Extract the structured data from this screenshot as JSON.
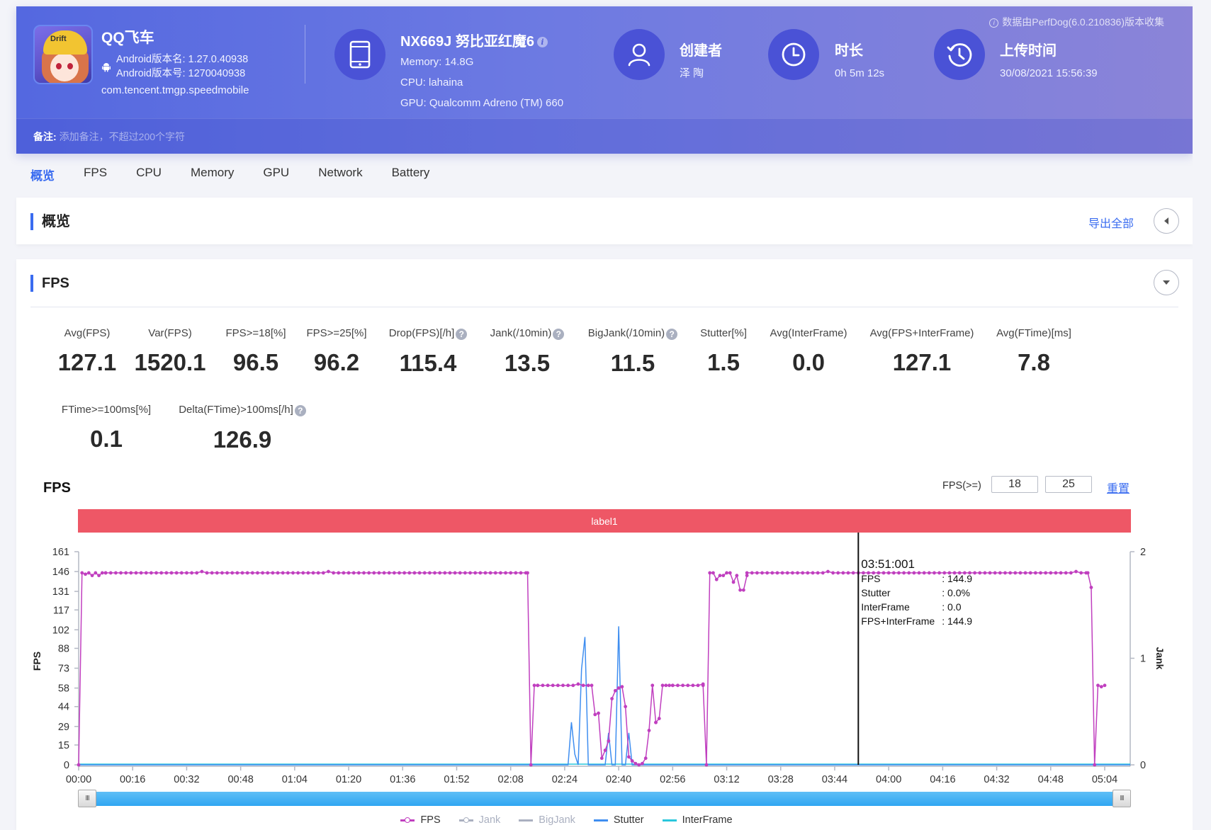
{
  "header": {
    "app": {
      "name": "QQ飞车",
      "version_name": "Android版本名: 1.27.0.40938",
      "version_code": "Android版本号: 1270040938",
      "package": "com.tencent.tmgp.speedmobile",
      "icon_text": "Drift"
    },
    "device": {
      "title": "NX669J 努比亚红魔6",
      "memory": "Memory: 14.8G",
      "cpu": "CPU: lahaina",
      "gpu": "GPU: Qualcomm Adreno (TM) 660",
      "info_icon": "i"
    },
    "creator": {
      "title": "创建者",
      "value": "泽 陶"
    },
    "duration": {
      "title": "时长",
      "value": "0h 5m 12s"
    },
    "upload": {
      "title": "上传时间",
      "value": "30/08/2021 15:56:39"
    },
    "collected_by": "数据由PerfDog(6.0.210836)版本收集",
    "notes_label": "备注:",
    "notes_placeholder": "添加备注，不超过200个字符"
  },
  "tabs": [
    {
      "label": "概览",
      "active": true
    },
    {
      "label": "FPS"
    },
    {
      "label": "CPU"
    },
    {
      "label": "Memory"
    },
    {
      "label": "GPU"
    },
    {
      "label": "Network"
    },
    {
      "label": "Battery"
    }
  ],
  "overview": {
    "title": "概览",
    "export_label": "导出全部"
  },
  "fps_section": {
    "title": "FPS",
    "metrics_row1": [
      {
        "label": "Avg(FPS)",
        "value": "127.1"
      },
      {
        "label": "Var(FPS)",
        "value": "1520.1"
      },
      {
        "label": "FPS>=18[%]",
        "value": "96.5"
      },
      {
        "label": "FPS>=25[%]",
        "value": "96.2"
      },
      {
        "label": "Drop(FPS)[/h]",
        "value": "115.4",
        "help": true
      },
      {
        "label": "Jank(/10min)",
        "value": "13.5",
        "help": true
      },
      {
        "label": "BigJank(/10min)",
        "value": "11.5",
        "help": true
      },
      {
        "label": "Stutter[%]",
        "value": "1.5"
      },
      {
        "label": "Avg(InterFrame)",
        "value": "0.0"
      },
      {
        "label": "Avg(FPS+InterFrame)",
        "value": "127.1"
      },
      {
        "label": "Avg(FTime)[ms]",
        "value": "7.8"
      }
    ],
    "metrics_row2": [
      {
        "label": "FTime>=100ms[%]",
        "value": "0.1"
      },
      {
        "label": "Delta(FTime)>100ms[/h]",
        "value": "126.9",
        "help": true
      }
    ],
    "help_glyph": "?",
    "chart_title": "FPS",
    "threshold_label": "FPS(>=)",
    "threshold_1": "18",
    "threshold_2": "25",
    "reset_label": "重置",
    "label_bar": "label1",
    "slider_handle_glyph": "III",
    "slider_range": [
      0,
      1
    ]
  },
  "chart_data": {
    "type": "line",
    "title": "FPS",
    "xlabel": "",
    "ylabel": "FPS",
    "y2label": "Jank",
    "ylim": [
      0,
      161
    ],
    "y2lim": [
      0,
      2
    ],
    "yticks": [
      "0",
      "15",
      "29",
      "44",
      "58",
      "73",
      "88",
      "102",
      "117",
      "131",
      "146",
      "161"
    ],
    "y2ticks": [
      "0",
      "1",
      "2"
    ],
    "xlim_seconds": [
      0,
      312
    ],
    "xticks": [
      "00:00",
      "00:16",
      "00:32",
      "00:48",
      "01:04",
      "01:20",
      "01:36",
      "01:52",
      "02:08",
      "02:24",
      "02:40",
      "02:56",
      "03:12",
      "03:28",
      "03:44",
      "04:00",
      "04:16",
      "04:32",
      "04:48",
      "05:04"
    ],
    "grid": false,
    "legend_position": "bottom",
    "legend": [
      {
        "name": "FPS",
        "color": "#c03fbf",
        "visible": true,
        "marker": true
      },
      {
        "name": "Jank",
        "color": "#aab0c0",
        "visible": false,
        "marker": true
      },
      {
        "name": "BigJank",
        "color": "#aab0c0",
        "visible": false,
        "marker": false
      },
      {
        "name": "Stutter",
        "color": "#3f8ef0",
        "visible": true,
        "marker": false
      },
      {
        "name": "InterFrame",
        "color": "#2ac7dc",
        "visible": true,
        "marker": false
      }
    ],
    "series": [
      {
        "name": "FPS",
        "segments": [
          {
            "x": [
              0,
              1,
              2,
              3,
              4,
              5,
              6,
              7,
              8
            ],
            "y": [
              0,
              145,
              144,
              145,
              143,
              145,
              143,
              145,
              145
            ]
          },
          {
            "flat": true,
            "from": 8,
            "to": 133,
            "value": 145
          },
          {
            "x": [
              133,
              134,
              135,
              136
            ],
            "y": [
              145,
              0,
              60,
              60
            ]
          },
          {
            "flat": true,
            "from": 136,
            "to": 152,
            "value": 60
          },
          {
            "x": [
              152,
              153,
              154,
              155,
              156,
              157,
              158,
              159,
              160,
              161,
              162,
              163,
              164,
              165,
              166,
              167,
              168,
              169,
              170,
              171
            ],
            "y": [
              60,
              38,
              39,
              5,
              11,
              18,
              50,
              56,
              58,
              59,
              44,
              6,
              3,
              1,
              0,
              1,
              5,
              26,
              60,
              32
            ]
          },
          {
            "x": [
              171,
              172,
              173,
              174,
              175,
              176
            ],
            "y": [
              32,
              35,
              60,
              60,
              60,
              60
            ]
          },
          {
            "flat": true,
            "from": 176,
            "to": 185,
            "value": 60
          },
          {
            "x": [
              185,
              186,
              187,
              188,
              189,
              190,
              191,
              192,
              193,
              194,
              195,
              196,
              197,
              198
            ],
            "y": [
              60,
              0,
              145,
              145,
              140,
              143,
              143,
              145,
              145,
              138,
              143,
              132,
              132,
              143
            ]
          },
          {
            "flat": true,
            "from": 198,
            "to": 299,
            "value": 145
          },
          {
            "x": [
              299,
              300,
              301,
              302,
              303,
              304
            ],
            "y": [
              145,
              134,
              0,
              60,
              59,
              60
            ]
          }
        ]
      },
      {
        "name": "Stutter",
        "x": [
          0,
          145,
          146,
          147,
          148,
          149,
          150,
          151,
          152,
          156,
          157,
          158,
          159,
          160,
          161,
          162,
          163,
          164,
          165,
          166,
          167,
          168,
          312
        ],
        "y": [
          0,
          0,
          0.4,
          0.1,
          0,
          0.9,
          1.2,
          0,
          0,
          0,
          0.3,
          0,
          0,
          1.3,
          0,
          0,
          0.3,
          0,
          0,
          0,
          0,
          0,
          0
        ]
      },
      {
        "name": "InterFrame",
        "x": [
          0,
          312
        ],
        "y": [
          0,
          0
        ]
      }
    ],
    "tooltip": {
      "time": "03:51:001",
      "x_seconds": 231,
      "rows": [
        {
          "key": "FPS",
          "value": ": 144.9"
        },
        {
          "key": "Stutter",
          "value": ": 0.0%"
        },
        {
          "key": "InterFrame",
          "value": ": 0.0"
        },
        {
          "key": "FPS+InterFrame",
          "value": ": 144.9"
        }
      ]
    }
  }
}
